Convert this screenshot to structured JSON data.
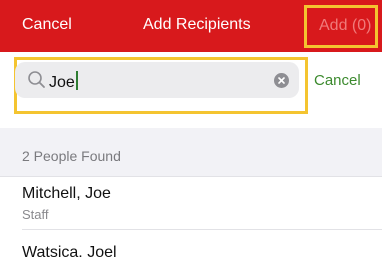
{
  "navbar": {
    "cancel_label": "Cancel",
    "title": "Add Recipients",
    "add_label": "Add (0)",
    "background": "#d8191c"
  },
  "search": {
    "value": "Joe",
    "cancel_label": "Cancel"
  },
  "results": {
    "header": "2 People Found",
    "people": [
      {
        "name": "Mitchell, Joe",
        "role": "Staff"
      },
      {
        "name": "Watsica, Joel",
        "role": ""
      }
    ]
  },
  "colors": {
    "highlight": "#f4c430",
    "accent_green": "#3c8a2e"
  }
}
